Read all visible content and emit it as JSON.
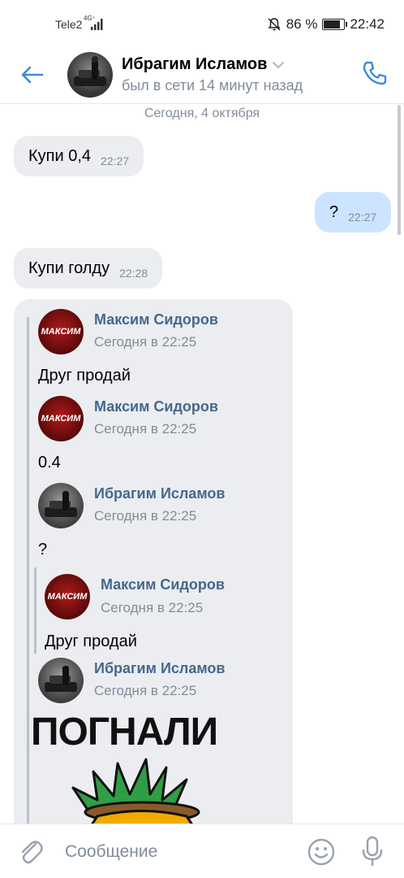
{
  "status_bar": {
    "carrier": "Tele2",
    "network": "4G⁺",
    "battery": "86 %",
    "battery_level": 0.86,
    "time": "22:42"
  },
  "header": {
    "name": "Ибрагим Исламов",
    "status": "был в сети 14 минут назад"
  },
  "chat": {
    "date": "Сегодня, 4 октября",
    "messages": [
      {
        "direction": "in",
        "text": "Купи 0,4",
        "time": "22:27"
      },
      {
        "direction": "out",
        "text": "?",
        "time": "22:27"
      },
      {
        "direction": "in",
        "text": "Купи голду",
        "time": "22:28"
      }
    ],
    "forwarded": [
      {
        "author": "Максим Сидоров",
        "time": "Сегодня в 22:25",
        "text": "Друг продай",
        "avatar_logo": "МАКСИМ"
      },
      {
        "author": "Максим Сидоров",
        "time": "Сегодня в 22:25",
        "text": "0.4",
        "avatar_logo": "МАКСИМ"
      },
      {
        "author": "Ибрагим Исламов",
        "time": "Сегодня в 22:25",
        "text": "?"
      },
      {
        "author": "Максим Сидоров",
        "time": "Сегодня в 22:25",
        "text": "Друг продай",
        "avatar_logo": "МАКСИМ"
      },
      {
        "author": "Ибрагим Исламов",
        "time": "Сегодня в 22:25",
        "sticker_text": "ПОГНАЛИ"
      }
    ]
  },
  "input": {
    "placeholder": "Сообщение"
  },
  "colors": {
    "accent": "#3f8ae0",
    "incoming_bubble": "#ebedf0",
    "outgoing_bubble": "#cce4ff",
    "author_name": "#45678f",
    "secondary_text": "#818c99"
  }
}
